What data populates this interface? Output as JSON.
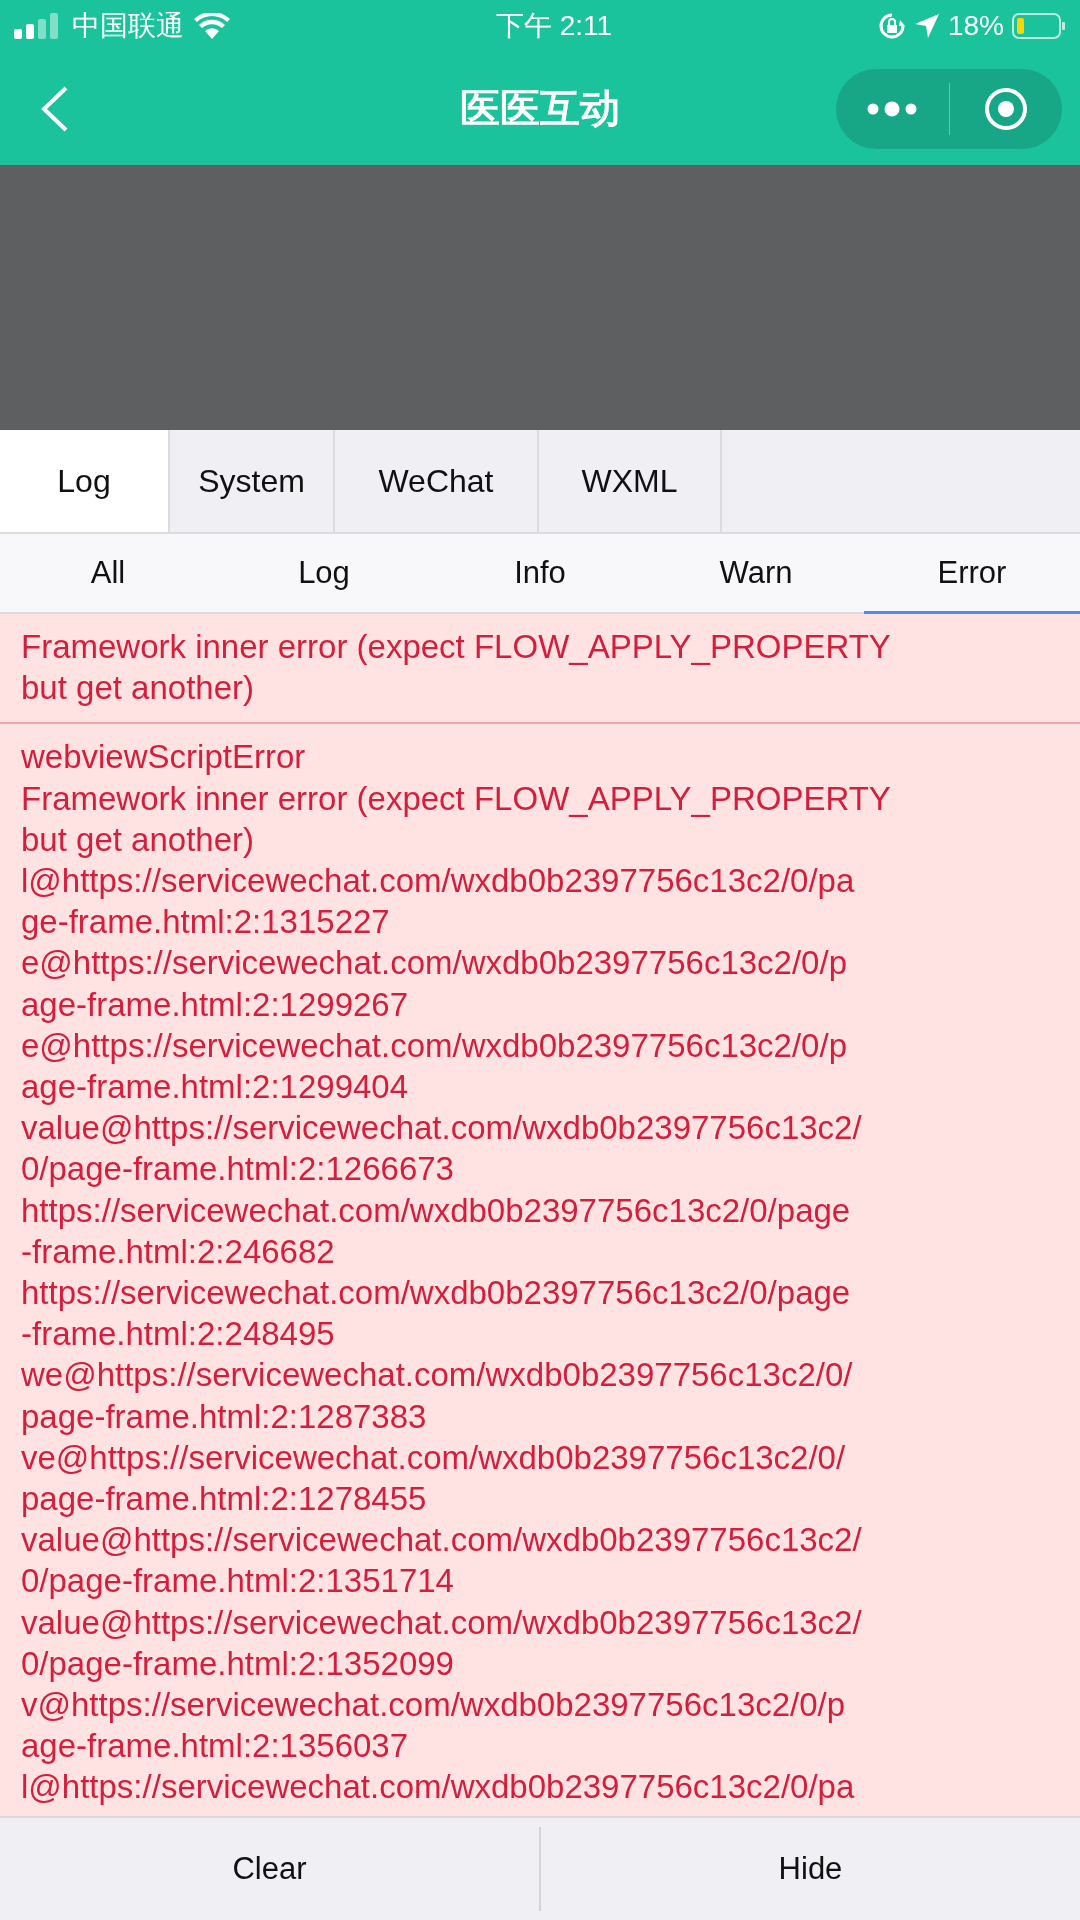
{
  "status_bar": {
    "carrier": "中国联通",
    "time": "下午 2:11",
    "battery": "18%"
  },
  "nav_bar": {
    "title": "医医互动"
  },
  "tabs": [
    {
      "label": "Log",
      "selected": true
    },
    {
      "label": "System",
      "selected": false
    },
    {
      "label": "WeChat",
      "selected": false
    },
    {
      "label": "WXML",
      "selected": false
    }
  ],
  "filters": [
    {
      "label": "All",
      "selected": false
    },
    {
      "label": "Log",
      "selected": false
    },
    {
      "label": "Info",
      "selected": false
    },
    {
      "label": "Warn",
      "selected": false
    },
    {
      "label": "Error",
      "selected": true
    }
  ],
  "entries": [
    {
      "lines": [
        "Framework inner error (expect FLOW_APPLY_PROPERTY",
        "but get another)"
      ]
    },
    {
      "lines": [
        "webviewScriptError",
        "Framework inner error (expect FLOW_APPLY_PROPERTY",
        "but get another)",
        "l@https://servicewechat.com/wxdb0b2397756c13c2/0/pa",
        "ge-frame.html:2:1315227",
        "e@https://servicewechat.com/wxdb0b2397756c13c2/0/p",
        "age-frame.html:2:1299267",
        "e@https://servicewechat.com/wxdb0b2397756c13c2/0/p",
        "age-frame.html:2:1299404",
        "value@https://servicewechat.com/wxdb0b2397756c13c2/",
        "0/page-frame.html:2:1266673",
        "https://servicewechat.com/wxdb0b2397756c13c2/0/page",
        "-frame.html:2:246682",
        "https://servicewechat.com/wxdb0b2397756c13c2/0/page",
        "-frame.html:2:248495",
        "we@https://servicewechat.com/wxdb0b2397756c13c2/0/",
        "page-frame.html:2:1287383",
        "ve@https://servicewechat.com/wxdb0b2397756c13c2/0/",
        "page-frame.html:2:1278455",
        "value@https://servicewechat.com/wxdb0b2397756c13c2/",
        "0/page-frame.html:2:1351714",
        "value@https://servicewechat.com/wxdb0b2397756c13c2/",
        "0/page-frame.html:2:1352099",
        "v@https://servicewechat.com/wxdb0b2397756c13c2/0/p",
        "age-frame.html:2:1356037",
        "l@https://servicewechat.com/wxdb0b2397756c13c2/0/pa"
      ]
    }
  ],
  "buttons": [
    {
      "label": "Clear"
    },
    {
      "label": "Hide"
    }
  ]
}
